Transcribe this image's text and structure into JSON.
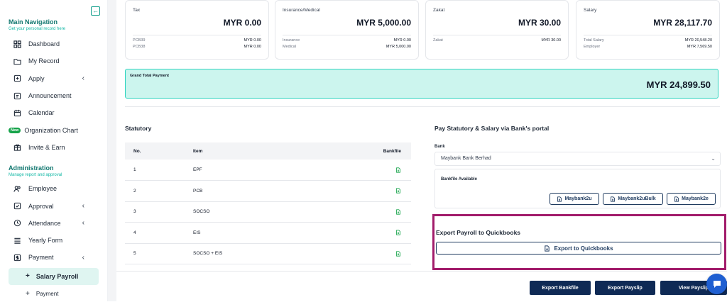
{
  "sidebar": {
    "main_title": "Main Navigation",
    "main_subtitle": "Get your personal record here",
    "main_items": [
      {
        "label": "Dashboard",
        "icon": "grid-icon"
      },
      {
        "label": "My Record",
        "icon": "folder-icon"
      },
      {
        "label": "Apply",
        "icon": "apply-icon",
        "chevron": true
      },
      {
        "label": "Announcement",
        "icon": "announcement-icon"
      },
      {
        "label": "Calendar",
        "icon": "calendar-icon"
      },
      {
        "label": "Organization Chart",
        "icon": "new-badge",
        "badge": "New"
      },
      {
        "label": "Invite & Earn",
        "icon": "gift-icon"
      }
    ],
    "admin_title": "Administration",
    "admin_subtitle": "Manage report and approval",
    "admin_items": [
      {
        "label": "Employee",
        "icon": "users-icon"
      },
      {
        "label": "Approval",
        "icon": "check-square-icon",
        "chevron": true
      },
      {
        "label": "Attendance",
        "icon": "clock-icon",
        "chevron": true
      },
      {
        "label": "Yearly Form",
        "icon": "list-icon"
      },
      {
        "label": "Payment",
        "icon": "payment-icon",
        "chevron": true
      }
    ],
    "active_item": "Salary Payroll",
    "cutoff_item": "Payment"
  },
  "cards": [
    {
      "label": "Tax",
      "amount": "MYR 0.00",
      "rows": [
        {
          "k": "PCB39",
          "v": "MYR 0.00"
        },
        {
          "k": "PCB38",
          "v": "MYR 0.00"
        }
      ]
    },
    {
      "label": "Insurance/Medical",
      "amount": "MYR 5,000.00",
      "rows": [
        {
          "k": "Insurance",
          "v": "MYR 0.00"
        },
        {
          "k": "Medical",
          "v": "MYR 5,000.00"
        }
      ]
    },
    {
      "label": "Zakat",
      "amount": "MYR 30.00",
      "rows": [
        {
          "k": "Zakat",
          "v": "MYR 30.00"
        }
      ]
    },
    {
      "label": "Salary",
      "amount": "MYR 28,117.70",
      "rows": [
        {
          "k": "Total Salary",
          "v": "MYR 20,548.20"
        },
        {
          "k": "Employer",
          "v": "MYR 7,569.50"
        }
      ]
    }
  ],
  "grand_total": {
    "label": "Grand Total Payment",
    "amount": "MYR 24,899.50"
  },
  "statutory": {
    "title": "Statutory",
    "headers": [
      "No.",
      "Item",
      "Bankfile"
    ],
    "rows": [
      {
        "no": "1",
        "item": "EPF"
      },
      {
        "no": "2",
        "item": "PCB"
      },
      {
        "no": "3",
        "item": "SOCSO"
      },
      {
        "no": "4",
        "item": "EIS"
      },
      {
        "no": "5",
        "item": "SOCSO + EIS"
      }
    ]
  },
  "bank_portal": {
    "title": "Pay Statutory & Salary via Bank's portal",
    "bank_label": "Bank",
    "bank_value": "Maybank Bank Berhad",
    "bankfile_label": "Bankfile Available",
    "buttons": [
      "Maybank2u",
      "Maybank2uBulk",
      "Maybank2e"
    ]
  },
  "quickbooks": {
    "title": "Export Payroll to Quickbooks",
    "button": "Export to Quickbooks"
  },
  "footer": {
    "export_bankfile": "Export Bankfile",
    "export_payslip": "Export Payslip",
    "view_payslip": "View Payslip"
  },
  "colors": {
    "accent": "#0f766e",
    "highlight": "#a21c6b",
    "primary_button": "#0f2a55",
    "grand_bg": "#ccf5ee"
  }
}
